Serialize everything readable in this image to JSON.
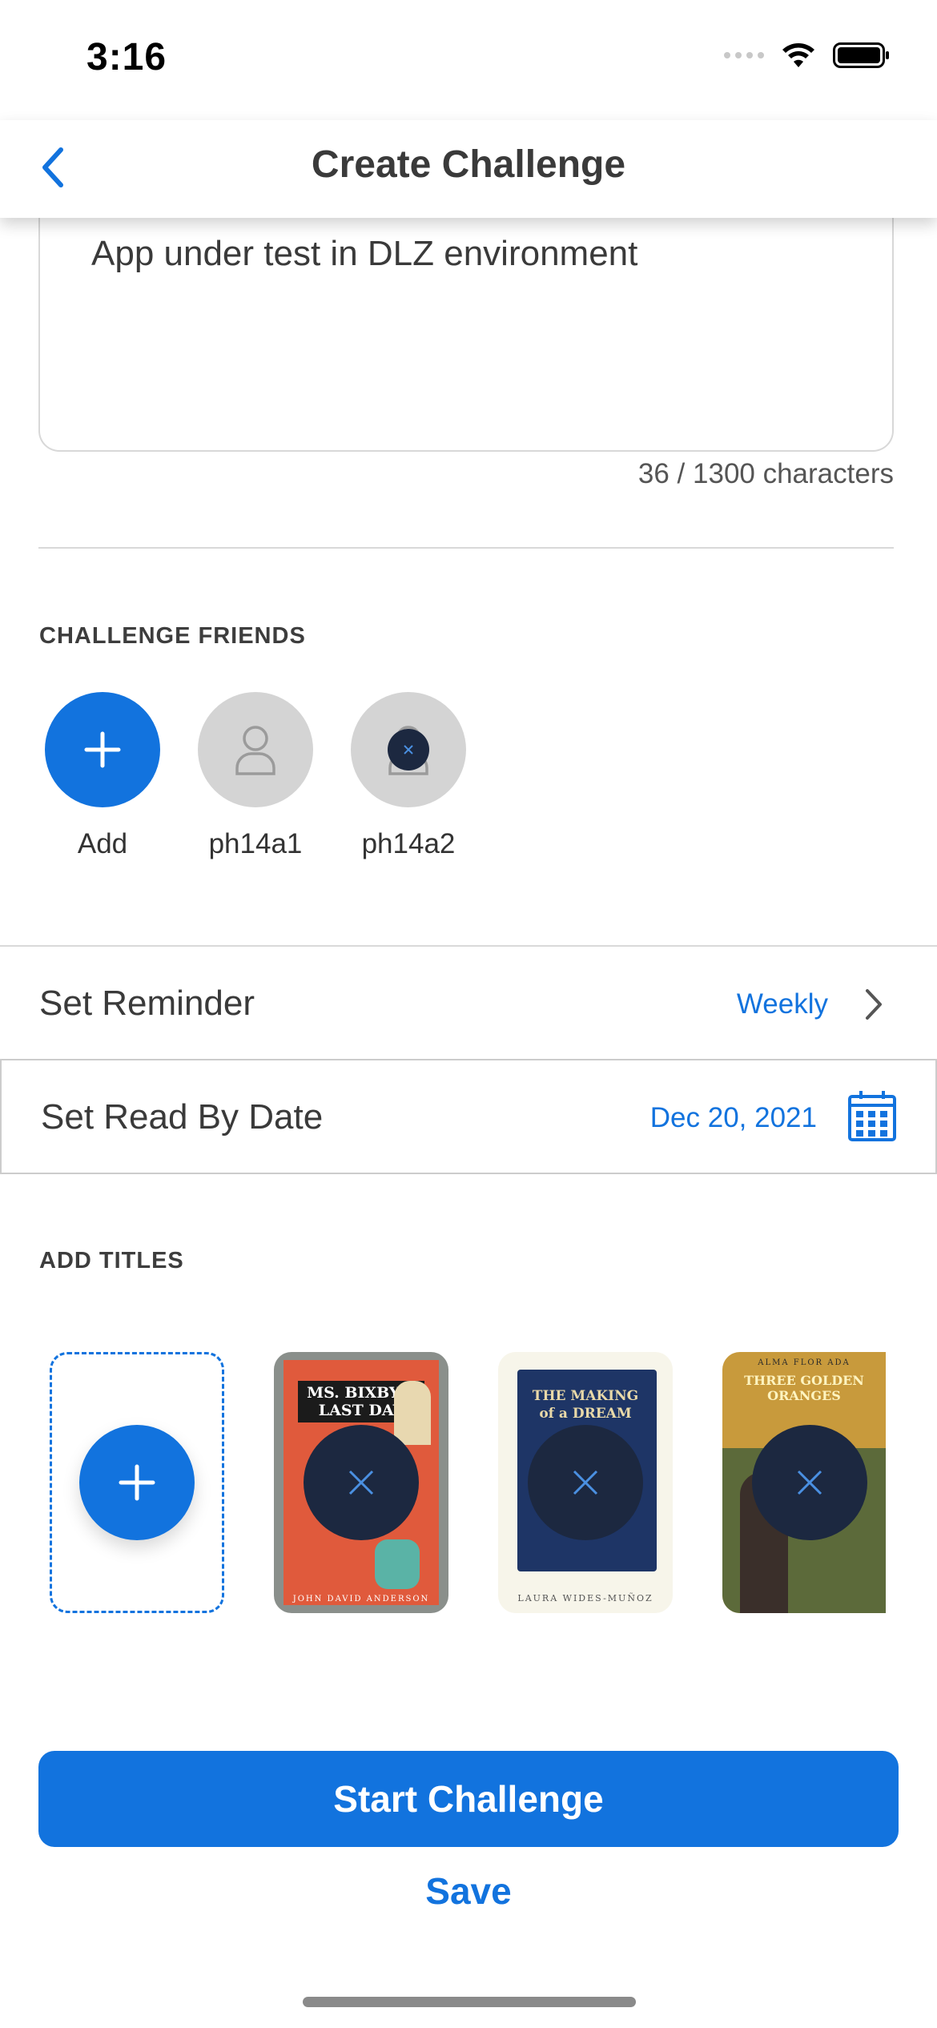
{
  "status_bar": {
    "time": "3:16"
  },
  "nav": {
    "title": "Create Challenge",
    "back_icon": "chevron-left-icon"
  },
  "description": {
    "text": "App under test in DLZ environment",
    "char_count": "36 / 1300 characters"
  },
  "friends_section": {
    "label": "CHALLENGE FRIENDS",
    "items": [
      {
        "name": "Add",
        "icon": "plus-icon"
      },
      {
        "name": "ph14a1",
        "icon": "user-icon"
      },
      {
        "name": "ph14a2",
        "icon": "close-icon"
      }
    ]
  },
  "reminder": {
    "label": "Set Reminder",
    "value": "Weekly"
  },
  "read_by": {
    "label": "Set Read By Date",
    "value": "Dec 20, 2021"
  },
  "titles_section": {
    "label": "ADD TITLES",
    "books": [
      {
        "cover_title": "MS. BIXBY'S LAST DAY",
        "author": "JOHN DAVID ANDERSON"
      },
      {
        "cover_title": "THE MAKING of a DREAM",
        "author": "LAURA WIDES-MUÑOZ"
      },
      {
        "cover_title": "THREE GOLDEN ORANGES",
        "author": "ALMA FLOR ADA"
      }
    ]
  },
  "actions": {
    "start": "Start Challenge",
    "save": "Save"
  },
  "colors": {
    "accent": "#1273de",
    "overlay": "#1c2840",
    "avatar_grey": "#d4d4d4"
  }
}
